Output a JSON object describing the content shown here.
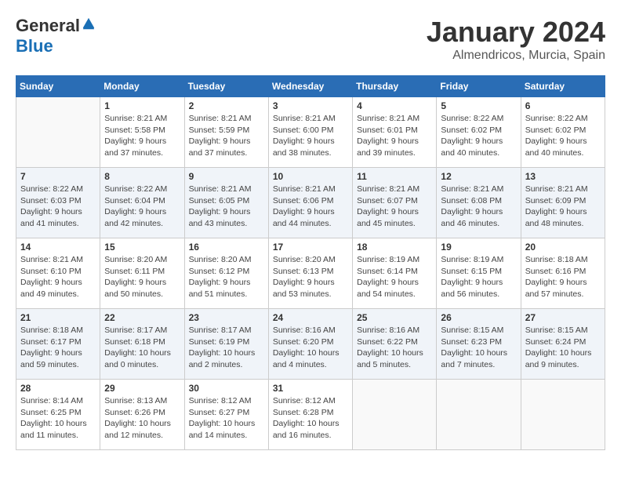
{
  "header": {
    "logo_line1": "General",
    "logo_line2": "Blue",
    "month": "January 2024",
    "location": "Almendricos, Murcia, Spain"
  },
  "weekdays": [
    "Sunday",
    "Monday",
    "Tuesday",
    "Wednesday",
    "Thursday",
    "Friday",
    "Saturday"
  ],
  "weeks": [
    [
      {
        "day": "",
        "sunrise": "",
        "sunset": "",
        "daylight": ""
      },
      {
        "day": "1",
        "sunrise": "Sunrise: 8:21 AM",
        "sunset": "Sunset: 5:58 PM",
        "daylight": "Daylight: 9 hours and 37 minutes."
      },
      {
        "day": "2",
        "sunrise": "Sunrise: 8:21 AM",
        "sunset": "Sunset: 5:59 PM",
        "daylight": "Daylight: 9 hours and 37 minutes."
      },
      {
        "day": "3",
        "sunrise": "Sunrise: 8:21 AM",
        "sunset": "Sunset: 6:00 PM",
        "daylight": "Daylight: 9 hours and 38 minutes."
      },
      {
        "day": "4",
        "sunrise": "Sunrise: 8:21 AM",
        "sunset": "Sunset: 6:01 PM",
        "daylight": "Daylight: 9 hours and 39 minutes."
      },
      {
        "day": "5",
        "sunrise": "Sunrise: 8:22 AM",
        "sunset": "Sunset: 6:02 PM",
        "daylight": "Daylight: 9 hours and 40 minutes."
      },
      {
        "day": "6",
        "sunrise": "Sunrise: 8:22 AM",
        "sunset": "Sunset: 6:02 PM",
        "daylight": "Daylight: 9 hours and 40 minutes."
      }
    ],
    [
      {
        "day": "7",
        "sunrise": "Sunrise: 8:22 AM",
        "sunset": "Sunset: 6:03 PM",
        "daylight": "Daylight: 9 hours and 41 minutes."
      },
      {
        "day": "8",
        "sunrise": "Sunrise: 8:22 AM",
        "sunset": "Sunset: 6:04 PM",
        "daylight": "Daylight: 9 hours and 42 minutes."
      },
      {
        "day": "9",
        "sunrise": "Sunrise: 8:21 AM",
        "sunset": "Sunset: 6:05 PM",
        "daylight": "Daylight: 9 hours and 43 minutes."
      },
      {
        "day": "10",
        "sunrise": "Sunrise: 8:21 AM",
        "sunset": "Sunset: 6:06 PM",
        "daylight": "Daylight: 9 hours and 44 minutes."
      },
      {
        "day": "11",
        "sunrise": "Sunrise: 8:21 AM",
        "sunset": "Sunset: 6:07 PM",
        "daylight": "Daylight: 9 hours and 45 minutes."
      },
      {
        "day": "12",
        "sunrise": "Sunrise: 8:21 AM",
        "sunset": "Sunset: 6:08 PM",
        "daylight": "Daylight: 9 hours and 46 minutes."
      },
      {
        "day": "13",
        "sunrise": "Sunrise: 8:21 AM",
        "sunset": "Sunset: 6:09 PM",
        "daylight": "Daylight: 9 hours and 48 minutes."
      }
    ],
    [
      {
        "day": "14",
        "sunrise": "Sunrise: 8:21 AM",
        "sunset": "Sunset: 6:10 PM",
        "daylight": "Daylight: 9 hours and 49 minutes."
      },
      {
        "day": "15",
        "sunrise": "Sunrise: 8:20 AM",
        "sunset": "Sunset: 6:11 PM",
        "daylight": "Daylight: 9 hours and 50 minutes."
      },
      {
        "day": "16",
        "sunrise": "Sunrise: 8:20 AM",
        "sunset": "Sunset: 6:12 PM",
        "daylight": "Daylight: 9 hours and 51 minutes."
      },
      {
        "day": "17",
        "sunrise": "Sunrise: 8:20 AM",
        "sunset": "Sunset: 6:13 PM",
        "daylight": "Daylight: 9 hours and 53 minutes."
      },
      {
        "day": "18",
        "sunrise": "Sunrise: 8:19 AM",
        "sunset": "Sunset: 6:14 PM",
        "daylight": "Daylight: 9 hours and 54 minutes."
      },
      {
        "day": "19",
        "sunrise": "Sunrise: 8:19 AM",
        "sunset": "Sunset: 6:15 PM",
        "daylight": "Daylight: 9 hours and 56 minutes."
      },
      {
        "day": "20",
        "sunrise": "Sunrise: 8:18 AM",
        "sunset": "Sunset: 6:16 PM",
        "daylight": "Daylight: 9 hours and 57 minutes."
      }
    ],
    [
      {
        "day": "21",
        "sunrise": "Sunrise: 8:18 AM",
        "sunset": "Sunset: 6:17 PM",
        "daylight": "Daylight: 9 hours and 59 minutes."
      },
      {
        "day": "22",
        "sunrise": "Sunrise: 8:17 AM",
        "sunset": "Sunset: 6:18 PM",
        "daylight": "Daylight: 10 hours and 0 minutes."
      },
      {
        "day": "23",
        "sunrise": "Sunrise: 8:17 AM",
        "sunset": "Sunset: 6:19 PM",
        "daylight": "Daylight: 10 hours and 2 minutes."
      },
      {
        "day": "24",
        "sunrise": "Sunrise: 8:16 AM",
        "sunset": "Sunset: 6:20 PM",
        "daylight": "Daylight: 10 hours and 4 minutes."
      },
      {
        "day": "25",
        "sunrise": "Sunrise: 8:16 AM",
        "sunset": "Sunset: 6:22 PM",
        "daylight": "Daylight: 10 hours and 5 minutes."
      },
      {
        "day": "26",
        "sunrise": "Sunrise: 8:15 AM",
        "sunset": "Sunset: 6:23 PM",
        "daylight": "Daylight: 10 hours and 7 minutes."
      },
      {
        "day": "27",
        "sunrise": "Sunrise: 8:15 AM",
        "sunset": "Sunset: 6:24 PM",
        "daylight": "Daylight: 10 hours and 9 minutes."
      }
    ],
    [
      {
        "day": "28",
        "sunrise": "Sunrise: 8:14 AM",
        "sunset": "Sunset: 6:25 PM",
        "daylight": "Daylight: 10 hours and 11 minutes."
      },
      {
        "day": "29",
        "sunrise": "Sunrise: 8:13 AM",
        "sunset": "Sunset: 6:26 PM",
        "daylight": "Daylight: 10 hours and 12 minutes."
      },
      {
        "day": "30",
        "sunrise": "Sunrise: 8:12 AM",
        "sunset": "Sunset: 6:27 PM",
        "daylight": "Daylight: 10 hours and 14 minutes."
      },
      {
        "day": "31",
        "sunrise": "Sunrise: 8:12 AM",
        "sunset": "Sunset: 6:28 PM",
        "daylight": "Daylight: 10 hours and 16 minutes."
      },
      {
        "day": "",
        "sunrise": "",
        "sunset": "",
        "daylight": ""
      },
      {
        "day": "",
        "sunrise": "",
        "sunset": "",
        "daylight": ""
      },
      {
        "day": "",
        "sunrise": "",
        "sunset": "",
        "daylight": ""
      }
    ]
  ]
}
